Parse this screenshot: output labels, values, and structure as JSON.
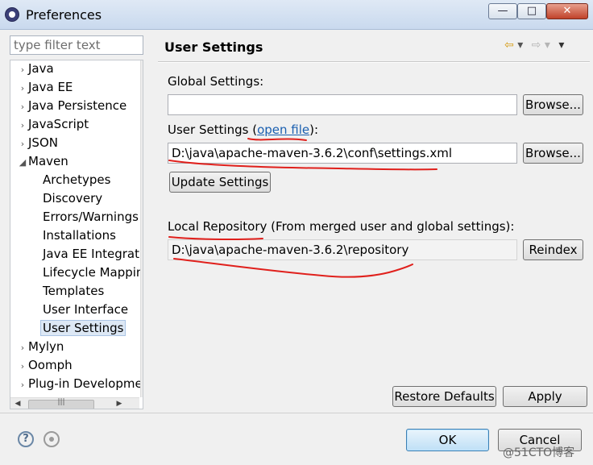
{
  "window": {
    "title": "Preferences",
    "minimize": "—",
    "maximize": "□",
    "close": "✕",
    "icon": "eclipse-icon"
  },
  "filter": {
    "placeholder": "type filter text"
  },
  "tree": {
    "items": [
      {
        "label": "Java",
        "arrow": "›",
        "level": 0
      },
      {
        "label": "Java EE",
        "arrow": "›",
        "level": 0
      },
      {
        "label": "Java Persistence",
        "arrow": "›",
        "level": 0
      },
      {
        "label": "JavaScript",
        "arrow": "›",
        "level": 0
      },
      {
        "label": "JSON",
        "arrow": "›",
        "level": 0
      },
      {
        "label": "Maven",
        "arrow": "◢",
        "level": 0
      },
      {
        "label": "Archetypes",
        "arrow": "",
        "level": 1
      },
      {
        "label": "Discovery",
        "arrow": "",
        "level": 1
      },
      {
        "label": "Errors/Warnings",
        "arrow": "",
        "level": 1
      },
      {
        "label": "Installations",
        "arrow": "",
        "level": 1
      },
      {
        "label": "Java EE Integration",
        "arrow": "",
        "level": 1
      },
      {
        "label": "Lifecycle Mappings",
        "arrow": "",
        "level": 1
      },
      {
        "label": "Templates",
        "arrow": "",
        "level": 1
      },
      {
        "label": "User Interface",
        "arrow": "",
        "level": 1
      },
      {
        "label": "User Settings",
        "arrow": "",
        "level": 1,
        "selected": true
      },
      {
        "label": "Mylyn",
        "arrow": "›",
        "level": 0
      },
      {
        "label": "Oomph",
        "arrow": "›",
        "level": 0
      },
      {
        "label": "Plug-in Development",
        "arrow": "›",
        "level": 0
      }
    ],
    "scroll_up": "▲",
    "scroll_down": "▼",
    "scroll_left": "◀",
    "scroll_right": "▶",
    "thumb_grip": "≡",
    "hthumb_grip": "|||"
  },
  "page": {
    "title": "User Settings",
    "nav": {
      "back": "⇦",
      "back_menu": "▾",
      "forward": "⇨",
      "forward_menu": "▾",
      "view_menu": "▾"
    },
    "global_settings_label": "Global Settings:",
    "global_settings_value": "",
    "browse_label": "Browse...",
    "user_settings_label_pre": "User Settings (",
    "open_file_link": "open file",
    "user_settings_label_post": "):",
    "user_settings_value": "D:\\java\\apache-maven-3.6.2\\conf\\settings.xml",
    "update_settings_label": "Update Settings",
    "local_repo_label": "Local Repository (From merged user and global settings):",
    "local_repo_value": "D:\\java\\apache-maven-3.6.2\\repository",
    "reindex_label": "Reindex",
    "restore_defaults_label": "Restore Defaults",
    "apply_label": "Apply"
  },
  "footer": {
    "help": "?",
    "ok_label": "OK",
    "cancel_label": "Cancel",
    "watermark": "@51CTO博客"
  },
  "colors": {
    "annotation": "#e0201c",
    "link": "#1a5fb0",
    "selection": "#dde8f5"
  }
}
